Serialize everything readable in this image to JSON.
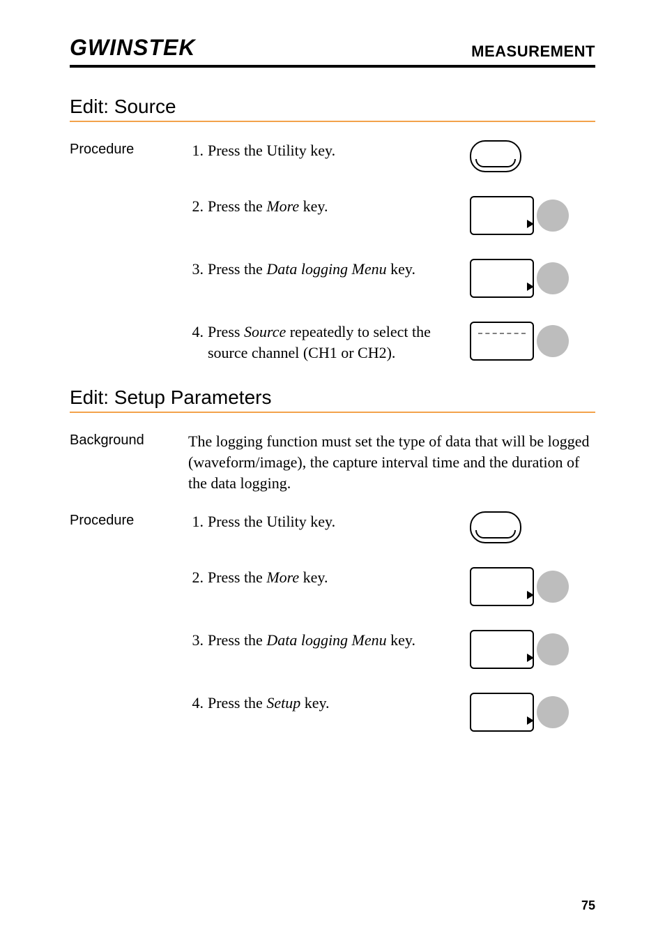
{
  "header": {
    "brand": "GWINSTEK",
    "right": "MEASUREMENT"
  },
  "section1": {
    "title": "Edit: Source",
    "procedure_label": "Procedure",
    "steps": [
      {
        "num": "1.",
        "text": "Press the Utility key."
      },
      {
        "num": "2.",
        "text_pre": "Press the ",
        "em": "More",
        "text_post": " key."
      },
      {
        "num": "3.",
        "text_pre": "Press the ",
        "em": "Data logging Menu",
        "text_post": " key."
      },
      {
        "num": "4.",
        "text_pre": "Press ",
        "em": "Source",
        "text_post": " repeatedly to select the source channel (CH1 or CH2)."
      }
    ]
  },
  "section2": {
    "title": "Edit: Setup Parameters",
    "background_label": "Background",
    "background_text": "The logging function must set the type of data that will be logged (waveform/image), the capture interval time and the duration of the data logging.",
    "procedure_label": "Procedure",
    "steps": [
      {
        "num": "1.",
        "text": "Press the Utility key."
      },
      {
        "num": "2.",
        "text_pre": "Press the ",
        "em": "More",
        "text_post": " key."
      },
      {
        "num": "3.",
        "text_pre": "Press the ",
        "em": "Data logging Menu",
        "text_post": " key."
      },
      {
        "num": "4.",
        "text_pre": "Press the ",
        "em": "Setup",
        "text_post": " key."
      }
    ]
  },
  "page_number": "75"
}
